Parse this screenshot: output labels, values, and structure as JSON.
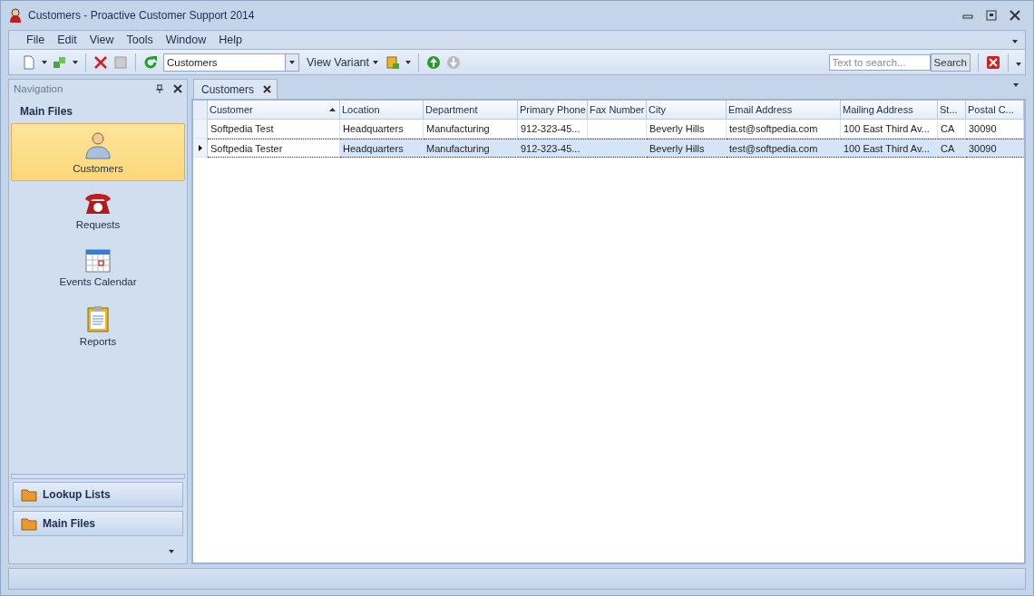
{
  "window": {
    "title": "Customers - Proactive Customer Support 2014"
  },
  "menu": [
    "File",
    "Edit",
    "View",
    "Tools",
    "Window",
    "Help"
  ],
  "toolbar": {
    "view_combo": {
      "value": "Customers"
    },
    "view_variant": "View Variant",
    "search": {
      "placeholder": "Text to search..."
    },
    "search_button": "Search"
  },
  "navigation": {
    "title": "Navigation",
    "group_title": "Main Files",
    "items": [
      {
        "label": "Customers",
        "kind": "person",
        "selected": true
      },
      {
        "label": "Requests",
        "kind": "phone",
        "selected": false
      },
      {
        "label": "Events Calendar",
        "kind": "calendar",
        "selected": false
      },
      {
        "label": "Reports",
        "kind": "clipboard",
        "selected": false
      }
    ],
    "groups": [
      {
        "label": "Lookup Lists"
      },
      {
        "label": "Main Files"
      }
    ]
  },
  "tabs": [
    {
      "label": "Customers",
      "selected": true
    }
  ],
  "table": {
    "columns": [
      {
        "label": "Customer",
        "sorted": true
      },
      {
        "label": "Location",
        "sorted": false
      },
      {
        "label": "Department",
        "sorted": false
      },
      {
        "label": "Primary Phone",
        "sorted": false
      },
      {
        "label": "Fax Number",
        "sorted": false
      },
      {
        "label": "City",
        "sorted": false
      },
      {
        "label": "Email Address",
        "sorted": false
      },
      {
        "label": "Mailing Address",
        "sorted": false
      },
      {
        "label": "St...",
        "sorted": false
      },
      {
        "label": "Postal C...",
        "sorted": false
      }
    ],
    "rows": [
      {
        "selected": false,
        "cells": [
          "Softpedia Test",
          "Headquarters",
          "Manufacturing",
          "912-323-45...",
          "",
          "Beverly Hills",
          "test@softpedia.com",
          "100 East Third Av...",
          "CA",
          "30090"
        ]
      },
      {
        "selected": true,
        "cells": [
          "Softpedia Tester",
          "Headquarters",
          "Manufacturing",
          "912-323-45...",
          "",
          "Beverly Hills",
          "test@softpedia.com",
          "100 East Third Av...",
          "CA",
          "30090"
        ]
      }
    ]
  }
}
